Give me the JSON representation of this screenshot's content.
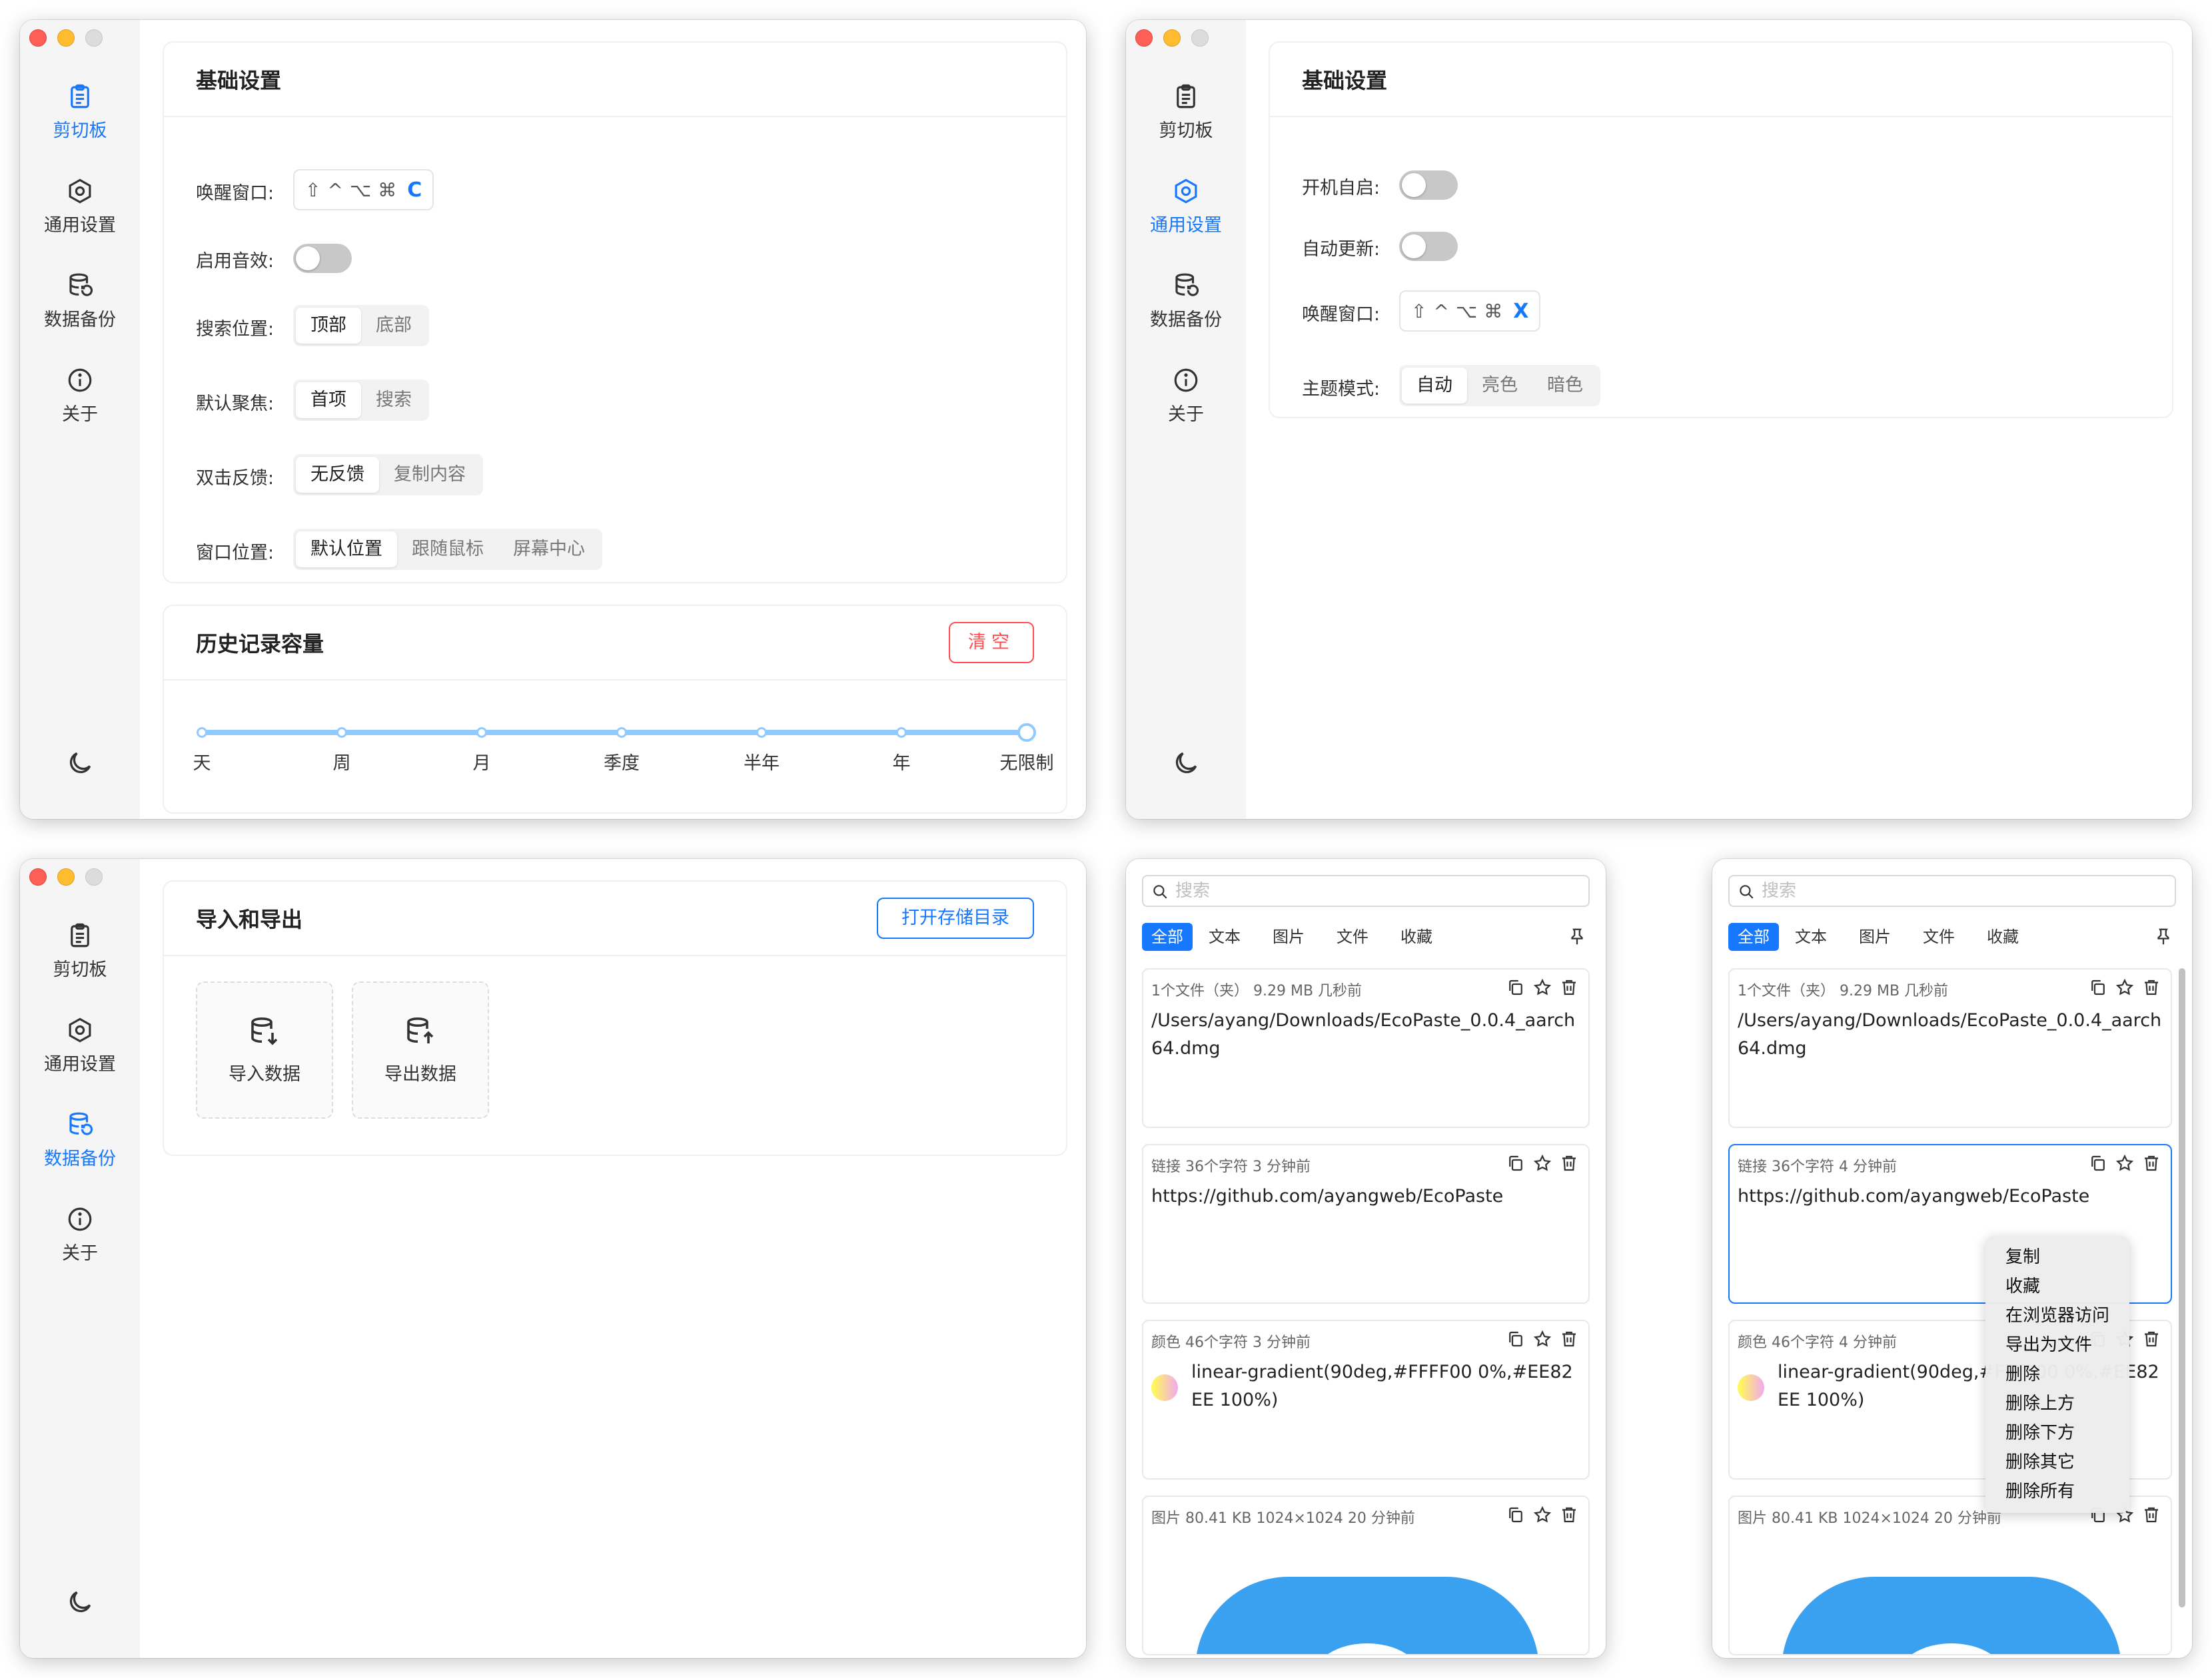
{
  "nav": {
    "clipboard": "剪切板",
    "general": "通用设置",
    "backup": "数据备份",
    "about": "关于"
  },
  "w1": {
    "basic_title": "基础设置",
    "wake_label": "唤醒窗口:",
    "wake_keys": [
      "⇧",
      "^",
      "⌥",
      "⌘"
    ],
    "wake_key_last": "C",
    "sound_label": "启用音效:",
    "search_pos_label": "搜索位置:",
    "search_pos_opts": [
      "顶部",
      "底部"
    ],
    "focus_label": "默认聚焦:",
    "focus_opts": [
      "首项",
      "搜索"
    ],
    "dblclick_label": "双击反馈:",
    "dblclick_opts": [
      "无反馈",
      "复制内容"
    ],
    "winpos_label": "窗口位置:",
    "winpos_opts": [
      "默认位置",
      "跟随鼠标",
      "屏幕中心"
    ],
    "history_title": "历史记录容量",
    "clear_button": "清空",
    "slider_marks": [
      "天",
      "周",
      "月",
      "季度",
      "半年",
      "年",
      "无限制"
    ],
    "slider_value": "无限制"
  },
  "w2": {
    "basic_title": "基础设置",
    "autostart_label": "开机自启:",
    "autoupdate_label": "自动更新:",
    "wake_label": "唤醒窗口:",
    "wake_keys": [
      "⇧",
      "^",
      "⌥",
      "⌘"
    ],
    "wake_key_last": "X",
    "theme_label": "主题模式:",
    "theme_opts": [
      "自动",
      "亮色",
      "暗色"
    ]
  },
  "w3": {
    "title": "导入和导出",
    "open_dir_button": "打开存储目录",
    "import_label": "导入数据",
    "export_label": "导出数据"
  },
  "clip": {
    "search_placeholder": "搜索",
    "tabs": [
      "全部",
      "文本",
      "图片",
      "文件",
      "收藏"
    ],
    "left_items": [
      {
        "meta": "1个文件（夹） 9.29 MB 几秒前",
        "content": "/Users/ayang/Downloads/EcoPaste_0.0.4_aarch64.dmg"
      },
      {
        "meta": "链接 36个字符 3 分钟前",
        "content": "https://github.com/ayangweb/EcoPaste"
      },
      {
        "meta": "颜色 46个字符 3 分钟前",
        "content": "linear-gradient(90deg,#FFFF00 0%,#EE82EE 100%)"
      },
      {
        "meta": "图片 80.41 KB 1024×1024 20 分钟前",
        "content": ""
      }
    ],
    "right_items": [
      {
        "meta": "1个文件（夹） 9.29 MB 几秒前",
        "content": "/Users/ayang/Downloads/EcoPaste_0.0.4_aarch64.dmg"
      },
      {
        "meta": "链接 36个字符 4 分钟前",
        "content": "https://github.com/ayangweb/EcoPaste"
      },
      {
        "meta": "颜色 46个字符 4 分钟前",
        "content": "linear-gradient(90deg,#FFFF00 0%,#EE82EE 100%)"
      },
      {
        "meta": "图片 80.41 KB 1024×1024 20 分钟前",
        "content": ""
      }
    ],
    "context_menu": [
      "复制",
      "收藏",
      "在浏览器访问",
      "导出为文件",
      "删除",
      "删除上方",
      "删除下方",
      "删除其它",
      "删除所有"
    ]
  },
  "colors": {
    "accent": "#1677ff",
    "danger": "#ff4d4f",
    "slider": "#91caff",
    "image_blue": "#3aa0f0"
  }
}
